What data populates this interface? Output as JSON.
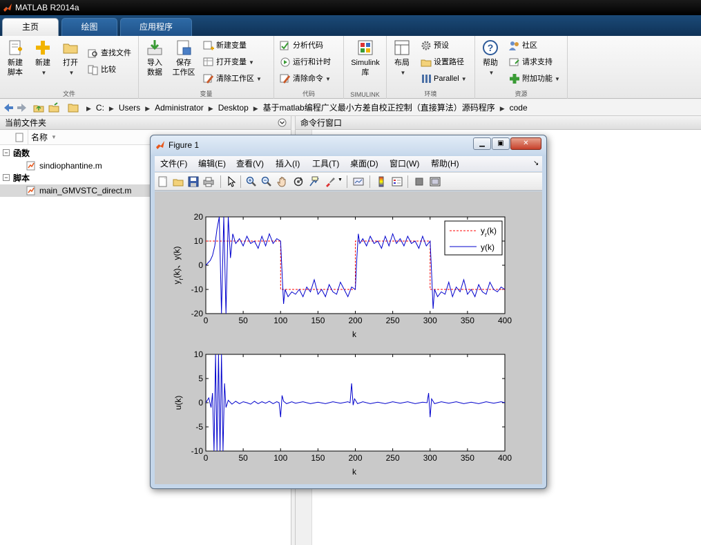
{
  "app": {
    "title": "MATLAB R2014a"
  },
  "tabs": [
    {
      "label": "主页",
      "active": true
    },
    {
      "label": "绘图",
      "active": false
    },
    {
      "label": "应用程序",
      "active": false
    }
  ],
  "ribbon": {
    "file": {
      "section_label": "文件",
      "new_script": "新建\n脚本",
      "new_script_l1": "新建",
      "new_script_l2": "脚本",
      "new": "新建",
      "open": "打开",
      "find_files": "查找文件",
      "compare": "比较"
    },
    "variable": {
      "section_label": "变量",
      "import_l1": "导入",
      "import_l2": "数据",
      "save_l1": "保存",
      "save_l2": "工作区",
      "new_variable": "新建变量",
      "open_variable": "打开变量",
      "clear_workspace": "清除工作区"
    },
    "code": {
      "section_label": "代码",
      "analyze": "分析代码",
      "run_time": "运行和计时",
      "clear_commands": "清除命令"
    },
    "simulink": {
      "section_label": "SIMULINK",
      "l1": "Simulink",
      "l2": "库"
    },
    "environment": {
      "section_label": "环境",
      "layout": "布局",
      "preferences": "预设",
      "set_path": "设置路径",
      "parallel": "Parallel"
    },
    "resources": {
      "section_label": "资源",
      "help": "帮助",
      "community": "社区",
      "request_support": "请求支持",
      "addons": "附加功能"
    }
  },
  "addressbar": {
    "crumbs": [
      "C:",
      "Users",
      "Administrator",
      "Desktop",
      "基于matlab编程广义最小方差自校正控制（直接算法）源码程序",
      "code"
    ]
  },
  "folder_pane": {
    "title": "当前文件夹",
    "column_name": "名称",
    "groups": [
      {
        "label": "函数",
        "files": [
          "sindiophantine.m"
        ]
      },
      {
        "label": "脚本",
        "files": [
          "main_GMVSTC_direct.m"
        ]
      }
    ]
  },
  "command_window": {
    "title": "命令行窗口"
  },
  "figure": {
    "title": "Figure 1",
    "menu": [
      "文件(F)",
      "编辑(E)",
      "查看(V)",
      "插入(I)",
      "工具(T)",
      "桌面(D)",
      "窗口(W)",
      "帮助(H)"
    ],
    "toolbar_icons": [
      "new-figure-icon",
      "open-icon",
      "save-icon",
      "print-icon",
      "edit-plot-icon",
      "zoom-in-icon",
      "zoom-out-icon",
      "pan-icon",
      "rotate-icon",
      "data-cursor-icon",
      "brush-icon",
      "link-icon",
      "colorbar-icon",
      "legend-icon",
      "hide-plot-tools-icon",
      "show-plot-tools-icon"
    ]
  },
  "colors": {
    "reference": "#ff0000",
    "output": "#0000cc",
    "control": "#0000cc"
  },
  "chart_data": [
    {
      "type": "line",
      "xlabel": "k",
      "ylabel": "y_r(k)、y(k)",
      "xlim": [
        0,
        400
      ],
      "ylim": [
        -20,
        20
      ],
      "xticks": [
        "0",
        "50",
        "100",
        "150",
        "200",
        "250",
        "300",
        "350",
        "400"
      ],
      "yticks": [
        "-20",
        "-10",
        "0",
        "10",
        "20"
      ],
      "legend": {
        "position": "top-right",
        "entries": [
          "y_r(k)",
          "y(k)"
        ]
      },
      "series": [
        {
          "name": "y_r(k)",
          "style": "dashed",
          "x": [
            0,
            100,
            100,
            200,
            200,
            300,
            300,
            400
          ],
          "y": [
            10,
            10,
            -10,
            -10,
            10,
            10,
            -10,
            -10
          ]
        },
        {
          "name": "y(k)",
          "style": "solid",
          "x": [
            0,
            3,
            6,
            9,
            12,
            15,
            18,
            21,
            24,
            27,
            30,
            33,
            36,
            40,
            45,
            50,
            55,
            60,
            65,
            70,
            75,
            80,
            85,
            90,
            95,
            100,
            102,
            104,
            106,
            110,
            115,
            120,
            125,
            130,
            135,
            140,
            145,
            150,
            155,
            160,
            165,
            170,
            175,
            180,
            185,
            190,
            195,
            200,
            202,
            204,
            206,
            210,
            215,
            220,
            225,
            230,
            235,
            240,
            245,
            250,
            255,
            260,
            265,
            270,
            275,
            280,
            285,
            290,
            295,
            300,
            302,
            304,
            306,
            310,
            315,
            320,
            325,
            330,
            335,
            340,
            345,
            350,
            355,
            360,
            365,
            370,
            375,
            380,
            385,
            390,
            395,
            400
          ],
          "y": [
            0,
            1,
            2,
            4,
            8,
            15,
            20,
            -20,
            20,
            -20,
            20,
            3,
            13,
            9,
            11,
            8,
            12,
            9,
            10,
            7,
            12,
            8,
            13,
            9,
            11,
            10,
            -3,
            -16,
            -10,
            -13,
            -11,
            -12,
            -10,
            -13,
            -9,
            -11,
            -6,
            -12,
            -10,
            -13,
            -8,
            -11,
            -12,
            -7,
            -10,
            -13,
            -9,
            -10,
            3,
            13,
            9,
            11,
            8,
            12,
            9,
            10,
            7,
            12,
            8,
            13,
            9,
            11,
            8,
            12,
            9,
            10,
            7,
            12,
            8,
            10,
            -3,
            -18,
            -10,
            -13,
            -11,
            -12,
            -7,
            -13,
            -9,
            -11,
            -6,
            -12,
            -10,
            -13,
            -8,
            -11,
            -12,
            -7,
            -10,
            -11,
            -9,
            -10
          ]
        }
      ]
    },
    {
      "type": "line",
      "xlabel": "k",
      "ylabel": "u(k)",
      "xlim": [
        0,
        400
      ],
      "ylim": [
        -10,
        10
      ],
      "xticks": [
        "0",
        "50",
        "100",
        "150",
        "200",
        "250",
        "300",
        "350",
        "400"
      ],
      "yticks": [
        "-10",
        "-5",
        "0",
        "5",
        "10"
      ],
      "series": [
        {
          "style": "solid",
          "x": [
            0,
            4,
            7,
            9,
            11,
            13,
            15,
            17,
            19,
            21,
            23,
            25,
            27,
            30,
            35,
            40,
            45,
            50,
            55,
            60,
            65,
            70,
            75,
            80,
            85,
            90,
            95,
            98,
            100,
            102,
            104,
            108,
            115,
            120,
            130,
            140,
            150,
            160,
            170,
            180,
            190,
            193,
            195,
            197,
            199,
            203,
            210,
            220,
            230,
            240,
            250,
            260,
            270,
            280,
            290,
            296,
            298,
            300,
            302,
            306,
            315,
            325,
            335,
            345,
            355,
            365,
            375,
            385,
            395,
            400
          ],
          "y": [
            0,
            1,
            -1,
            2,
            -10,
            10,
            -10,
            10,
            -10,
            10,
            -10,
            4,
            -1,
            0.5,
            -0.3,
            0.3,
            -0.2,
            0.2,
            0,
            -0.3,
            0.3,
            -0.2,
            0.2,
            -0.1,
            0.3,
            -0.2,
            0.2,
            0,
            -3,
            1.5,
            0.3,
            -0.2,
            0.2,
            -0.1,
            0.2,
            -0.2,
            0.1,
            -0.2,
            0.2,
            -0.1,
            0.2,
            0,
            4,
            -0.5,
            0.8,
            -0.2,
            0.2,
            -0.2,
            0.1,
            -0.2,
            0.2,
            -0.1,
            0.2,
            -0.2,
            0.1,
            0,
            2,
            -3,
            0.8,
            -0.2,
            0.2,
            -0.1,
            0.2,
            -0.2,
            0.1,
            -0.2,
            0.2,
            -0.1,
            0.2,
            0
          ]
        }
      ]
    }
  ]
}
